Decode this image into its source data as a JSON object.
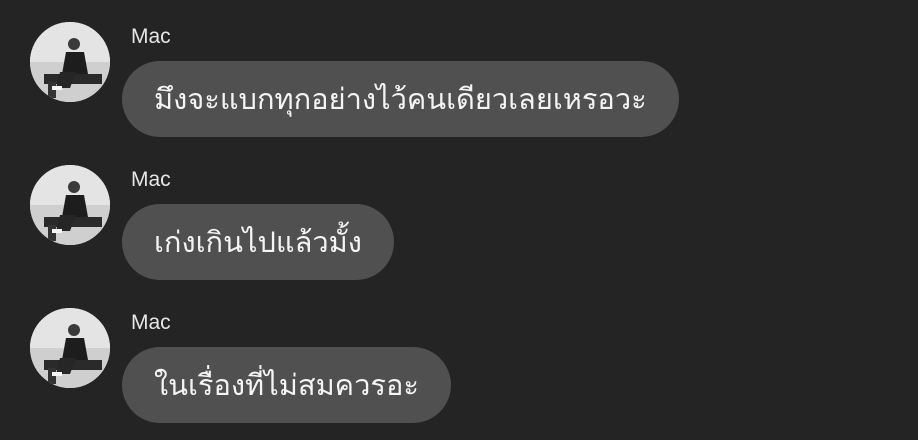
{
  "messages": [
    {
      "sender": "Mac",
      "text": "มึงจะแบกทุกอย่างไว้คนเดียวเลยเหรอวะ",
      "avatar_icon": "profile-photo"
    },
    {
      "sender": "Mac",
      "text": "เก่งเกินไปแล้วมั้ง",
      "avatar_icon": "profile-photo"
    },
    {
      "sender": "Mac",
      "text": "ในเรื่องที่ไม่สมควรอะ",
      "avatar_icon": "profile-photo"
    }
  ],
  "colors": {
    "background": "#242424",
    "bubble": "#505050",
    "text": "#f4f4f4"
  }
}
